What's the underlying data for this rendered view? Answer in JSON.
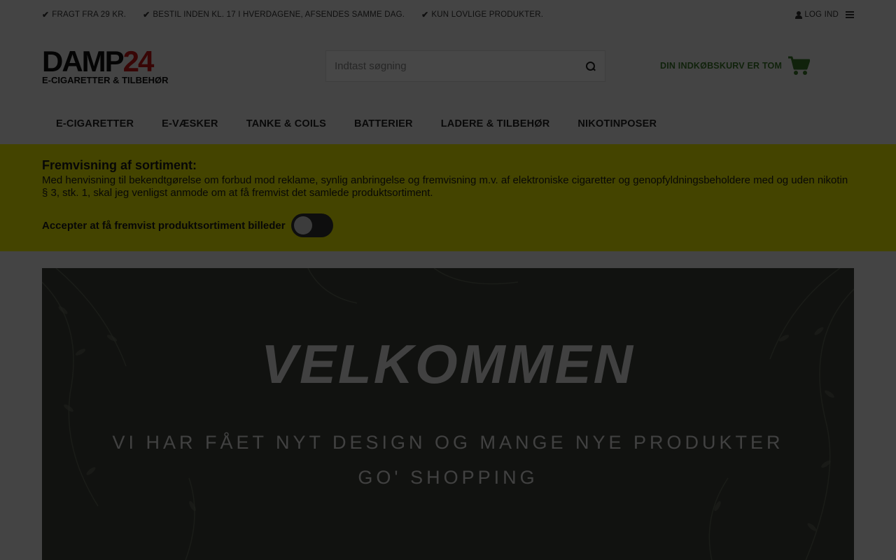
{
  "topbar": {
    "usps": [
      "FRAGT FRA 29 KR.",
      "BESTIL INDEN KL. 17 I HVERDAGENE, AFSENDES SAMME DAG.",
      "KUN LOVLIGE PRODUKTER."
    ],
    "login_label": "LOG IND"
  },
  "header": {
    "logo_main": "DAMP",
    "logo_number": "24",
    "logo_sub": "E-CIGARETTER & TILBEHØR",
    "search_placeholder": "Indtast søgning",
    "cart_label": "DIN INDKØBSKURV ER TOM"
  },
  "nav": {
    "items": [
      "E-CIGARETTER",
      "E-VÆSKER",
      "TANKE & COILS",
      "BATTERIER",
      "LADERE & TILBEHØR",
      "NIKOTINPOSER"
    ]
  },
  "notice": {
    "title": "Fremvisning af sortiment:",
    "text": "Med henvisning til bekendtgørelse om forbud mod reklame, synlig anbringelse og fremvisning m.v. af elektroniske cigaretter og genopfyldningsbeholdere med og uden nikotin § 3, stk. 1, skal jeg venligst anmode om at få fremvist det samlede produktsortiment.",
    "accept_label": "Accepter at få fremvist produktsortiment billeder",
    "toggle_on": false
  },
  "banner": {
    "title": "VELKOMMEN",
    "subtitle": "VI HAR FÅET NYT DESIGN OG MANGE NYE PRODUKTER",
    "subtitle2": "GO' SHOPPING"
  },
  "colors": {
    "accent_green": "#3c7a2a",
    "logo_red": "#c81818",
    "notice_yellow": "#f2f200",
    "banner_bg": "#3f433a"
  },
  "icons": [
    "check-icon",
    "user-icon",
    "menu-icon",
    "search-icon",
    "cart-icon"
  ]
}
